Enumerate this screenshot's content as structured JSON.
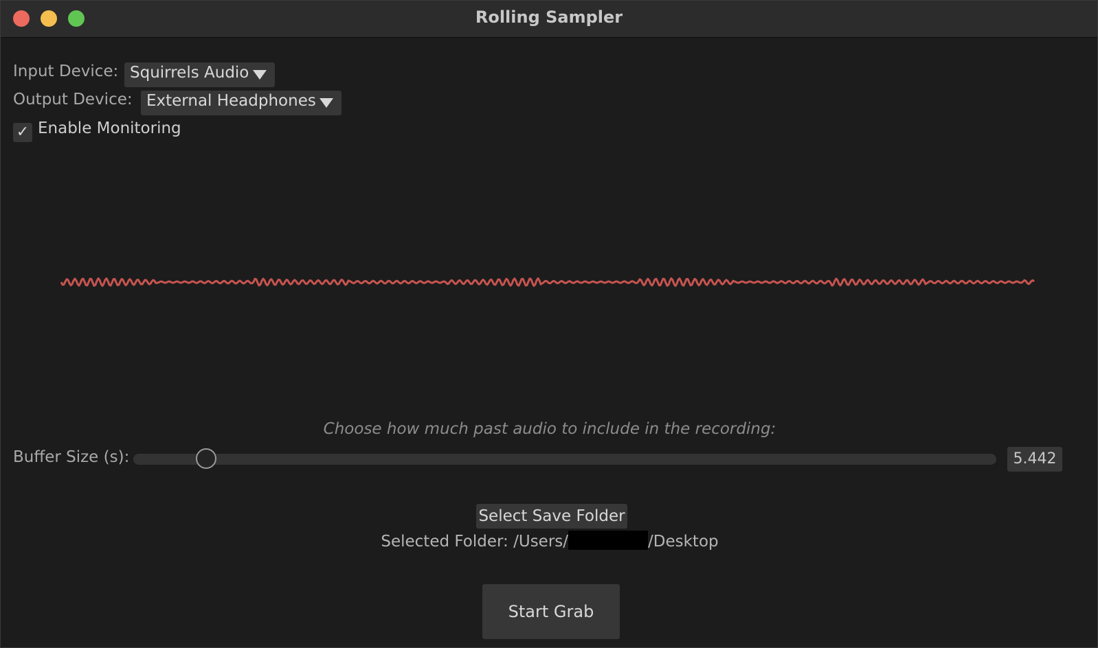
{
  "window": {
    "title": "Rolling Sampler"
  },
  "input_device": {
    "label": "Input Device:",
    "value": "Squirrels Audio"
  },
  "output_device": {
    "label": "Output Device:",
    "value": "External Headphones"
  },
  "monitoring": {
    "label": "Enable Monitoring",
    "checked": true,
    "check_glyph": "✓"
  },
  "waveform": {
    "color": "#c75450"
  },
  "buffer": {
    "hint": "Choose how much past audio to include in the recording:",
    "label": "Buffer Size (s):",
    "value": "5.442",
    "fraction": 0.084
  },
  "save_folder": {
    "button_label": "Select Save Folder",
    "selected_prefix": "Selected Folder: /Users/",
    "selected_suffix": "/Desktop"
  },
  "start_button": {
    "label": "Start Grab"
  }
}
